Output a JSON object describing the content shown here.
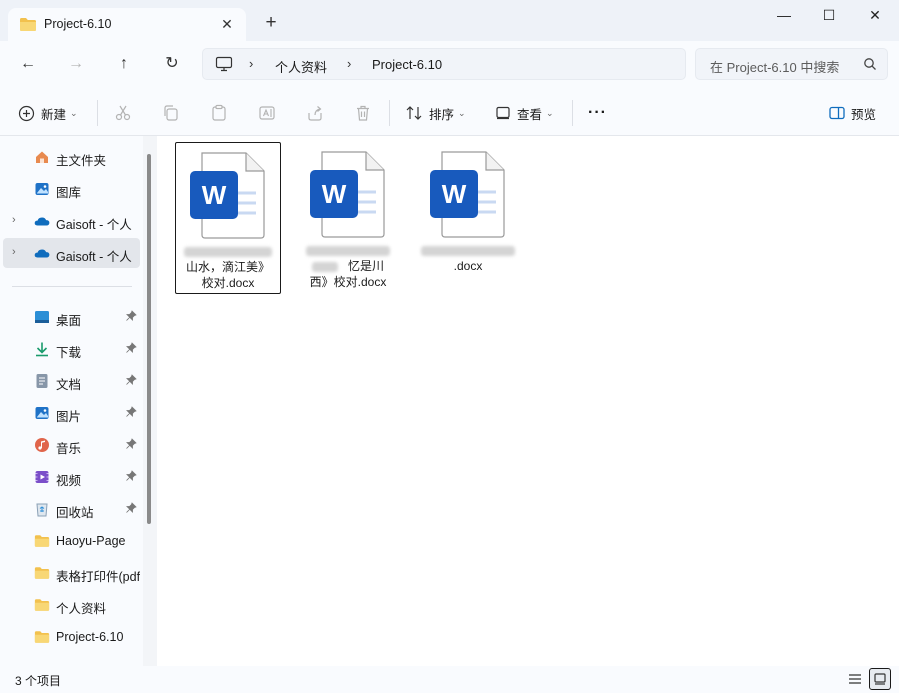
{
  "tab": {
    "title": "Project-6.10",
    "close_glyph": "✕",
    "new_glyph": "+"
  },
  "window": {
    "minimize_glyph": "—",
    "maximize_glyph": "☐",
    "close_glyph": "✕"
  },
  "nav": {
    "back_glyph": "←",
    "forward_glyph": "→",
    "up_glyph": "↑",
    "refresh_glyph": "↻"
  },
  "address": {
    "separator": "›",
    "segments": [
      "个人资料",
      "Project-6.10"
    ]
  },
  "search": {
    "placeholder": "在 Project-6.10 中搜索"
  },
  "toolbar": {
    "new_label": "新建",
    "sort_label": "排序",
    "view_label": "查看",
    "more_glyph": "···",
    "preview_label": "预览",
    "dropdown_glyph": "⌄"
  },
  "sidebar": {
    "items": [
      {
        "label": "主文件夹",
        "icon": "home-icon"
      },
      {
        "label": "图库",
        "icon": "gallery-icon"
      },
      {
        "label": "Gaisoft - 个人",
        "icon": "onedrive-icon"
      },
      {
        "label": "Gaisoft - 个人",
        "icon": "onedrive-icon"
      }
    ],
    "quick_access": [
      {
        "label": "桌面",
        "icon": "desktop-icon"
      },
      {
        "label": "下载",
        "icon": "download-icon"
      },
      {
        "label": "文档",
        "icon": "document-icon"
      },
      {
        "label": "图片",
        "icon": "pictures-icon"
      },
      {
        "label": "音乐",
        "icon": "music-icon"
      },
      {
        "label": "视频",
        "icon": "video-icon"
      },
      {
        "label": "回收站",
        "icon": "recycle-bin-icon"
      },
      {
        "label": "Haoyu-Page",
        "icon": "folder-icon"
      },
      {
        "label": "表格打印件(pdf",
        "icon": "folder-icon"
      },
      {
        "label": "个人资料",
        "icon": "folder-icon"
      },
      {
        "label": "Project-6.10",
        "icon": "folder-icon"
      }
    ]
  },
  "files": [
    {
      "line1": "山水，滴江美》",
      "line2": "校对.docx"
    },
    {
      "line1": "忆是川",
      "line2": "西》校对.docx"
    },
    {
      "line1": "",
      "line2": ".docx"
    }
  ],
  "file_icon_letter": "W",
  "status": {
    "item_count": "3 个项目"
  },
  "colors": {
    "word_blue": "#185abd",
    "folder_yellow": "#f2c14e",
    "onedrive_blue": "#0f6cbd"
  }
}
